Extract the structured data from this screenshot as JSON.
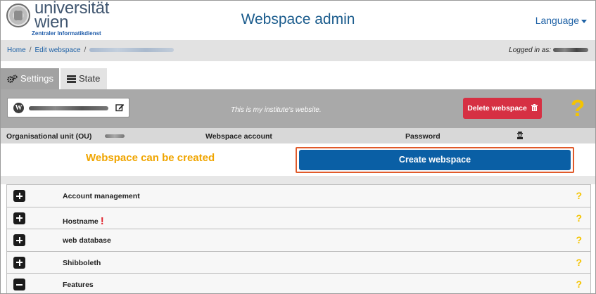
{
  "header": {
    "university": "universität",
    "university_line2": "wien",
    "department": "Zentraler Informatikdienst",
    "app_title": "Webspace admin",
    "language_label": "Language"
  },
  "breadcrumb": {
    "home": "Home",
    "edit_webspace": "Edit webspace",
    "logged_in_label": "Logged in as:"
  },
  "tabs": [
    {
      "label": "Settings",
      "active": true
    },
    {
      "label": "State",
      "active": false
    }
  ],
  "webspace": {
    "description": "This is my institute's website.",
    "delete_label": "Delete webspace",
    "help_symbol": "?"
  },
  "account_header": {
    "ou_label": "Organisational unit (OU)",
    "account_label": "Webspace account",
    "password_label": "Password"
  },
  "create": {
    "status": "Webspace can be created",
    "button_label": "Create webspace"
  },
  "sections": [
    {
      "label": "Account management",
      "expanded": false,
      "warning": false
    },
    {
      "label": "Hostname",
      "expanded": false,
      "warning": true
    },
    {
      "label": "web database",
      "expanded": false,
      "warning": false
    },
    {
      "label": "Shibboleth",
      "expanded": false,
      "warning": false
    },
    {
      "label": "Features",
      "expanded": true,
      "warning": false
    }
  ],
  "colors": {
    "brand_blue": "#0a5fa5",
    "delete_red": "#d63043",
    "status_orange": "#f0a500",
    "help_yellow": "#f5c400"
  },
  "icons": {
    "settings": "gears-icon",
    "state": "list-icon",
    "wordpress": "wordpress-icon",
    "edit": "edit-icon",
    "trash": "trash-icon",
    "password": "user-secret-icon",
    "expand": "plus-square-icon",
    "collapse": "minus-square-icon"
  }
}
